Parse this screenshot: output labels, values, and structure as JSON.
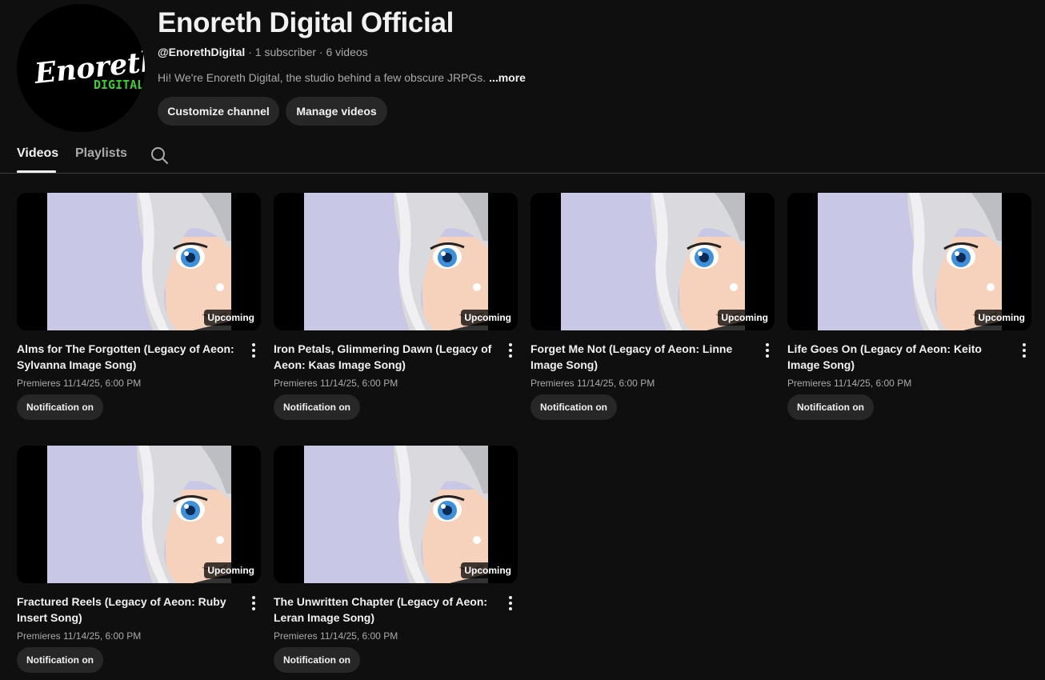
{
  "channel": {
    "logo_text": "Enoreth",
    "logo_sub": "DIGITAL",
    "title": "Enoreth Digital Official",
    "handle": "@EnorethDigital",
    "separator1": " · ",
    "subscribers": "1 subscriber",
    "separator2": " · ",
    "video_count": "6 videos",
    "description": "Hi! We're Enoreth Digital, the studio behind a few obscure JRPGs. ",
    "more_label": "...more",
    "customize_label": "Customize channel",
    "manage_label": "Manage videos"
  },
  "tabs": [
    {
      "label": "Videos",
      "active": true
    },
    {
      "label": "Playlists",
      "active": false
    }
  ],
  "videos": [
    {
      "title": "Alms for The Forgotten (Legacy of Aeon: Sylvanna Image Song)",
      "badge": "Upcoming",
      "premiere": "Premieres 11/14/25, 6:00 PM",
      "notification": "Notification on"
    },
    {
      "title": "Iron Petals, Glimmering Dawn (Legacy of Aeon: Kaas Image Song)",
      "badge": "Upcoming",
      "premiere": "Premieres 11/14/25, 6:00 PM",
      "notification": "Notification on"
    },
    {
      "title": "Forget Me Not (Legacy of Aeon: Linne Image Song)",
      "badge": "Upcoming",
      "premiere": "Premieres 11/14/25, 6:00 PM",
      "notification": "Notification on"
    },
    {
      "title": "Life Goes On (Legacy of Aeon: Keito Image Song)",
      "badge": "Upcoming",
      "premiere": "Premieres 11/14/25, 6:00 PM",
      "notification": "Notification on"
    },
    {
      "title": "Fractured Reels (Legacy of Aeon: Ruby Insert Song)",
      "badge": "Upcoming",
      "premiere": "Premieres 11/14/25, 6:00 PM",
      "notification": "Notification on"
    },
    {
      "title": "The Unwritten Chapter (Legacy of Aeon: Leran Image Song)",
      "badge": "Upcoming",
      "premiere": "Premieres 11/14/25, 6:00 PM",
      "notification": "Notification on"
    }
  ],
  "icons": {
    "search": "search-icon",
    "more_vert": "more-vert-icon"
  },
  "colors": {
    "background": "#0f0f0f",
    "button": "#272727",
    "logo_green": "#39d12a",
    "thumb_bg": "#c8c8e6"
  }
}
